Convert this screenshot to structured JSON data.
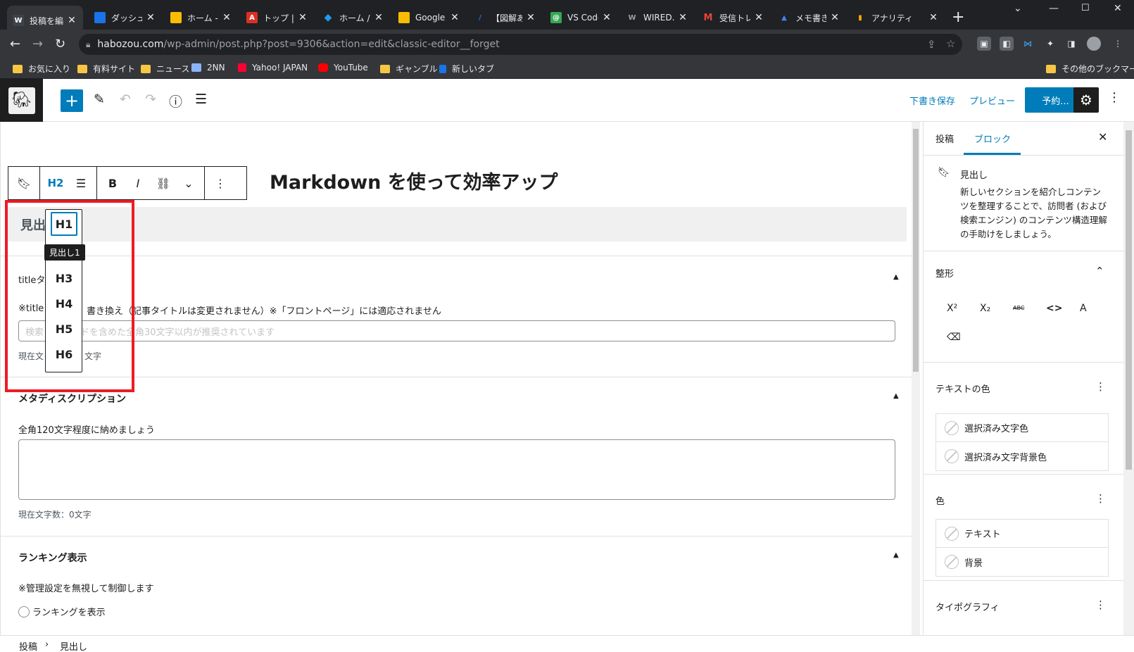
{
  "browser": {
    "tabs": [
      {
        "title": "投稿を編",
        "icon": "wordpress-favicon",
        "color": "#3c434a",
        "active": true
      },
      {
        "title": "ダッシュボ",
        "icon": "dashboard-favicon",
        "color": "#1a73e8",
        "active": false
      },
      {
        "title": "ホーム - G",
        "icon": "google-ads-favicon",
        "color": "#fbbc04",
        "active": false
      },
      {
        "title": "トップ | A",
        "icon": "a8-favicon",
        "color": "#d93025",
        "active": false
      },
      {
        "title": "ホーム / Tw",
        "icon": "twitter-favicon",
        "color": "#1d9bf0",
        "active": false
      },
      {
        "title": "Google I",
        "icon": "google-keep-favicon",
        "color": "#fbbc04",
        "active": false
      },
      {
        "title": "【図解あり",
        "icon": "article-favicon",
        "color": "#1a73e8",
        "active": false
      },
      {
        "title": "VS Code",
        "icon": "at-favicon",
        "color": "#34a853",
        "active": false
      },
      {
        "title": "WIRED.jp",
        "icon": "wired-favicon",
        "color": "#5f6368",
        "active": false
      },
      {
        "title": "受信トレイ",
        "icon": "gmail-favicon",
        "color": "#ea4335",
        "active": false
      },
      {
        "title": "メモ書きや",
        "icon": "memo-favicon",
        "color": "#4285f4",
        "active": false
      },
      {
        "title": "アナリティ",
        "icon": "analytics-favicon",
        "color": "#f9ab00",
        "active": false
      }
    ],
    "url_domain": "habozou.com",
    "url_path": "/wp-admin/post.php?post=9306&action=edit&classic-editor__forget",
    "bookmarks": [
      {
        "label": "お気に入り",
        "icon": "folder-icon"
      },
      {
        "label": "有料サイト",
        "icon": "folder-icon"
      },
      {
        "label": "ニュース",
        "icon": "folder-icon"
      },
      {
        "label": "2NN",
        "icon": "2nn-icon"
      },
      {
        "label": "Yahoo! JAPAN",
        "icon": "yahoo-icon"
      },
      {
        "label": "YouTube",
        "icon": "youtube-icon"
      },
      {
        "label": "ギャンブル",
        "icon": "folder-icon"
      },
      {
        "label": "新しいタブ",
        "icon": "download-icon"
      }
    ],
    "other_bookmarks": "その他のブックマーク"
  },
  "wp_header": {
    "save_draft": "下書き保存",
    "preview": "プレビュー",
    "schedule": "予約..."
  },
  "block_toolbar": {
    "heading_level": "H2",
    "bold": "B",
    "italic": "I"
  },
  "post": {
    "heading": "Markdown を使って効率アップ"
  },
  "level_menu": {
    "items": [
      "H1",
      "H3",
      "H4",
      "H5",
      "H6"
    ],
    "tooltip": "見出し1"
  },
  "meta": {
    "top_label": "見出",
    "title_panel": {
      "title": "titleタ",
      "note_a": "※title",
      "note_b": "書き換え（記事タイトルは変更されません）※「フロントページ」には適応されません",
      "placeholder_a": "検索",
      "placeholder_b": "ドを含めた全角30文字以内が推奨されています",
      "count_a": "現在文",
      "count_b": "文字"
    },
    "description_panel": {
      "title": "メタディスクリプション",
      "note": "全角120文字程度に納めましょう",
      "count": "現在文字数：0文字"
    },
    "ranking_panel": {
      "title": "ランキング表示",
      "note": "※管理設定を無視して制御します",
      "option": "ランキングを表示"
    }
  },
  "breadcrumb": {
    "items": [
      "投稿",
      "見出し"
    ]
  },
  "sidebar": {
    "tabs": [
      "投稿",
      "ブロック"
    ],
    "block": {
      "title": "見出し",
      "description": "新しいセクションを紹介しコンテンツを整理することで、訪問者 (および検索エンジン) のコンテンツ構造理解の手助けをしましょう。"
    },
    "format": {
      "title": "整形",
      "superscript": "X²",
      "subscript": "X₂",
      "strikethrough": "ABC",
      "code": "<>",
      "font": "A"
    },
    "text_color": {
      "title": "テキストの色",
      "items": [
        "選択済み文字色",
        "選択済み文字背景色"
      ]
    },
    "color": {
      "title": "色",
      "items": [
        "テキスト",
        "背景"
      ]
    },
    "typography": {
      "title": "タイポグラフィ"
    }
  },
  "colors": {
    "accent": "#007cba",
    "highlight": "#ed1c24",
    "chrome_dark": "#202124"
  }
}
